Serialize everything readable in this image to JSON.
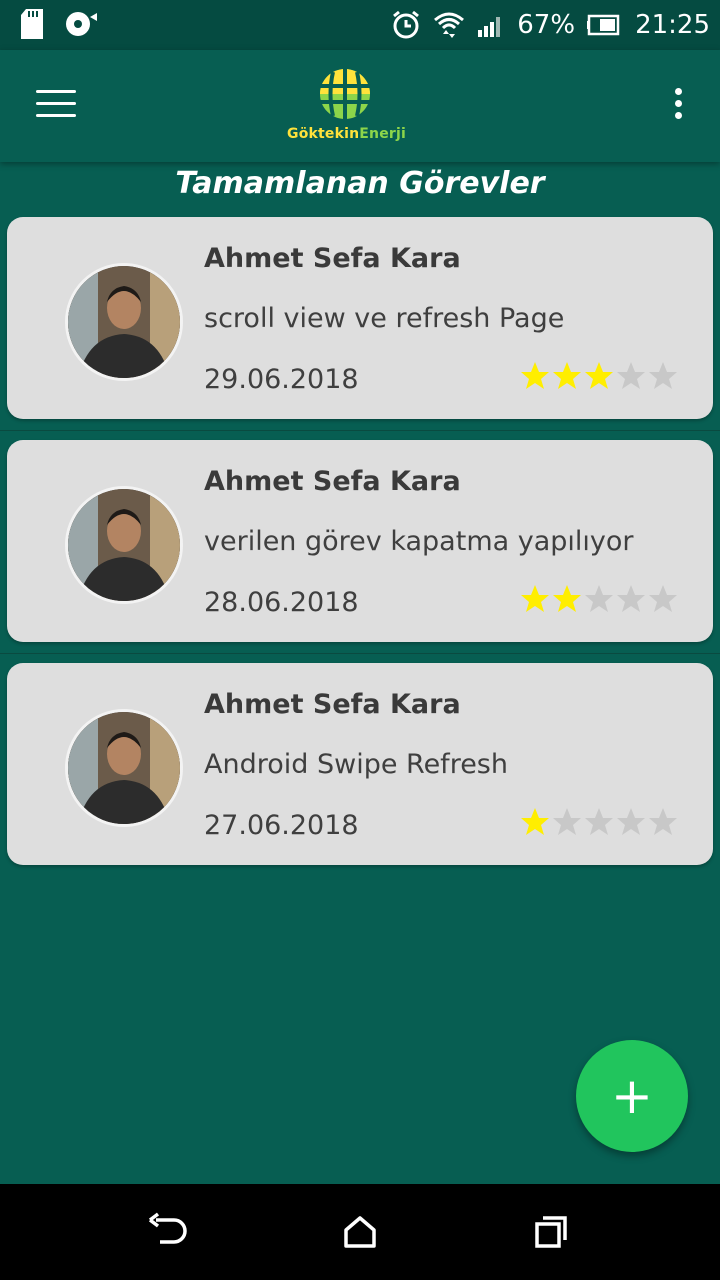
{
  "status_bar": {
    "battery": "67%",
    "time": "21:25",
    "icons": [
      "sd-card-icon",
      "sync-disc-icon",
      "alarm-icon",
      "wifi-icon",
      "signal-icon",
      "battery-icon"
    ]
  },
  "app_bar": {
    "logo_text_part1": "Göktekin",
    "logo_text_part2": "Enerji",
    "menu_icon": "hamburger-menu-icon",
    "overflow_icon": "more-vertical-icon"
  },
  "page": {
    "title": "Tamamlanan Görevler"
  },
  "tasks": [
    {
      "name": "Ahmet Sefa Kara",
      "description": "scroll view ve refresh Page",
      "date": "29.06.2018",
      "rating": 3,
      "max_rating": 5
    },
    {
      "name": "Ahmet Sefa Kara",
      "description": "verilen görev kapatma yapılıyor",
      "date": "28.06.2018",
      "rating": 2,
      "max_rating": 5
    },
    {
      "name": "Ahmet Sefa Kara",
      "description": "Android Swipe Refresh",
      "date": "27.06.2018",
      "rating": 1,
      "max_rating": 5
    }
  ],
  "fab": {
    "label": "+"
  },
  "colors": {
    "primary": "#075e52",
    "status_bar": "#054b41",
    "card": "#dedede",
    "accent": "#21c55d",
    "star_filled": "#ffee00",
    "star_empty": "#c8c8c8"
  },
  "nav_bar": {
    "icons": [
      "back-icon",
      "home-icon",
      "recents-icon"
    ]
  }
}
